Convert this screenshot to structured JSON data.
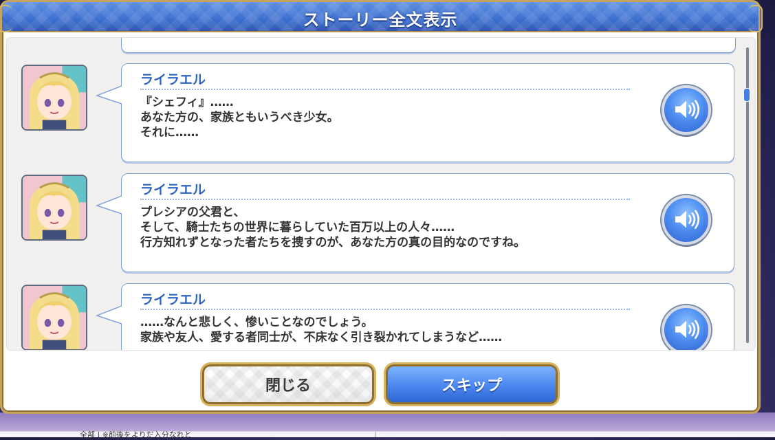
{
  "dialog": {
    "title": "ストーリー全文表示"
  },
  "log_entries": [
    {
      "speaker": "ライラエル",
      "text": "『シェフィ』……\nあなた方の、家族ともいうべき少女。\nそれに……",
      "avatar_icon": "character-portrait-icon",
      "voice_icon": "speaker-icon"
    },
    {
      "speaker": "ライラエル",
      "text": "プレシアの父君と、\nそして、騎士たちの世界に暮らしていた百万以上の人々……\n行方知れずとなった者たちを捜すのが、あなた方の真の目的なのですね。",
      "avatar_icon": "character-portrait-icon",
      "voice_icon": "speaker-icon"
    },
    {
      "speaker": "ライラエル",
      "text": "……なんと悲しく、惨いことなのでしょう。\n家族や友人、愛する者同士が、不床なく引き裂かれてしまうなど……",
      "avatar_icon": "character-portrait-icon",
      "voice_icon": "speaker-icon"
    }
  ],
  "buttons": {
    "close_label": "閉じる",
    "skip_label": "スキップ"
  },
  "background": {
    "footer_text": "全部 | ※前後をよりだ入分なれと"
  },
  "colors": {
    "header_blue": "#3d6fcf",
    "speaker_name": "#2f66c0",
    "gold_border": "#c6a45d",
    "skip_button": "#4a87ee"
  }
}
